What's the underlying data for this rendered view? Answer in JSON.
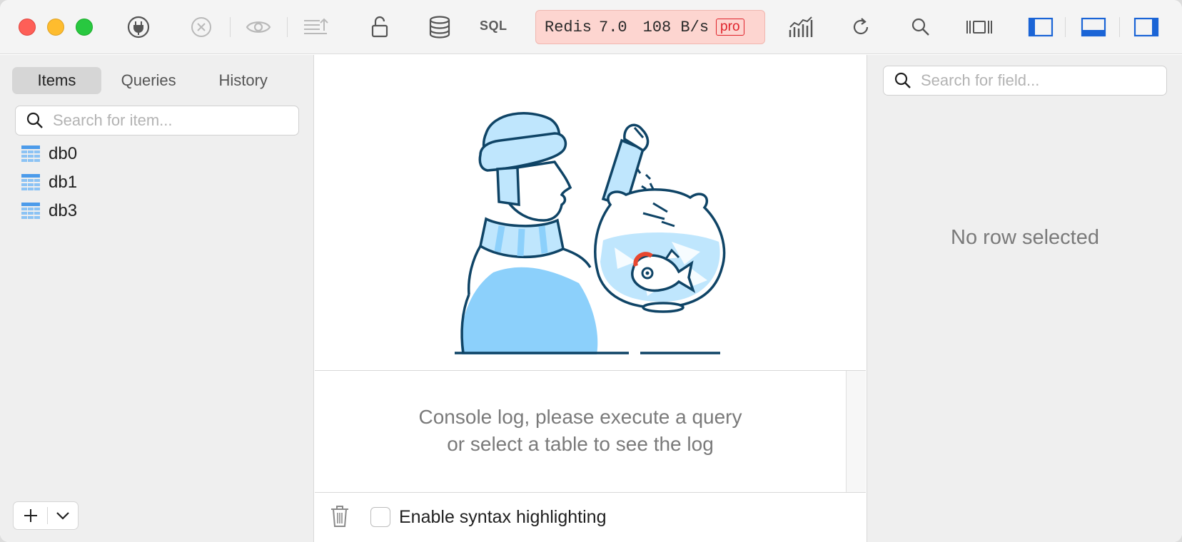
{
  "toolbar": {
    "sql_label": "SQL",
    "status": {
      "engine": "Redis",
      "version": "7.0",
      "throughput": "108 B/s",
      "badge": "pro",
      "bg_color": "#fdd5d0",
      "badge_color": "#e0222a"
    },
    "icons": [
      "plug-icon",
      "close-circle-icon",
      "eye-icon",
      "commit-changes-icon",
      "unlock-icon",
      "database-icon",
      "chart-icon",
      "refresh-icon",
      "search-icon",
      "row-view-icon",
      "toggle-left-panel-icon",
      "toggle-bottom-panel-icon",
      "toggle-right-panel-icon"
    ]
  },
  "sidebar": {
    "tabs": [
      {
        "label": "Items",
        "active": true
      },
      {
        "label": "Queries",
        "active": false
      },
      {
        "label": "History",
        "active": false
      }
    ],
    "search_placeholder": "Search for item...",
    "items": [
      {
        "label": "db0",
        "icon": "table-icon"
      },
      {
        "label": "db1",
        "icon": "table-icon"
      },
      {
        "label": "db3",
        "icon": "table-icon"
      }
    ]
  },
  "console": {
    "message_line1": "Console log, please execute a query",
    "message_line2": "or select a table to see the log",
    "syntax_label": "Enable syntax highlighting",
    "syntax_enabled": false
  },
  "right_panel": {
    "search_placeholder": "Search for field...",
    "empty_text": "No row selected"
  },
  "colors": {
    "accent": "#1a64d6",
    "illustration_stroke": "#0f4466",
    "illustration_fill": "#8cd0fb"
  }
}
